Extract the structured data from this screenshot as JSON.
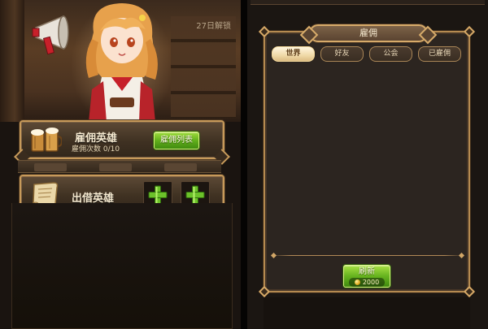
{
  "left_screen": {
    "timer_text": "27日解锁",
    "hire_card": {
      "title": "雇佣英雄",
      "subtitle": "雇佣次数 0/10",
      "button_label": "雇佣列表",
      "icon": "beer-mugs-icon"
    },
    "lend_card": {
      "title": "出借英雄",
      "icon": "scroll-icon",
      "slots": [
        {
          "icon": "plus-icon"
        },
        {
          "icon": "plus-icon"
        }
      ]
    }
  },
  "right_screen": {
    "panel_title": "雇佣",
    "tabs": [
      {
        "label": "世界",
        "active": true
      },
      {
        "label": "好友",
        "active": false
      },
      {
        "label": "公会",
        "active": false
      },
      {
        "label": "已雇佣",
        "active": false
      }
    ],
    "refresh_button": {
      "label": "刷新",
      "cost": "2000",
      "currency_icon": "gold-coin-icon"
    }
  },
  "colors": {
    "frame_gold": "#c79a5a",
    "button_green": "#62b01c",
    "tab_active": "#f0d9a8",
    "panel_bg": "#2c2520"
  }
}
